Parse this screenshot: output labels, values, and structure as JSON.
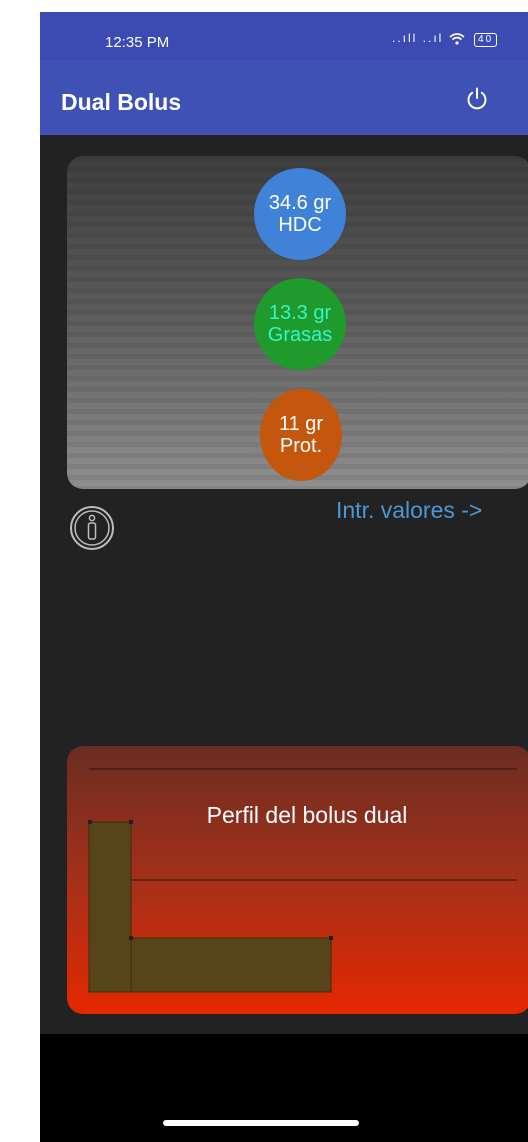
{
  "status_bar": {
    "time": "12:35 PM",
    "signal": "..ıll ..ıl",
    "battery": "40"
  },
  "app_bar": {
    "title": "Dual Bolus",
    "power_icon": "power-icon"
  },
  "macros": {
    "carbs": {
      "value": "34.6 gr",
      "label": "HDC",
      "color": "#3f82d8"
    },
    "fat": {
      "value": "13.3 gr",
      "label": "Grasas",
      "color": "#1f9a2c"
    },
    "protein": {
      "value": "11 gr",
      "label": "Prot.",
      "color": "#c4560d"
    }
  },
  "actions": {
    "info_icon": "info-icon",
    "enter_values": "Intr. valores ->"
  },
  "profile": {
    "title": "Perfil del bolus dual",
    "color_top": "#6b2d22",
    "color_bottom": "#e52800",
    "bolus_color": "#574418"
  }
}
